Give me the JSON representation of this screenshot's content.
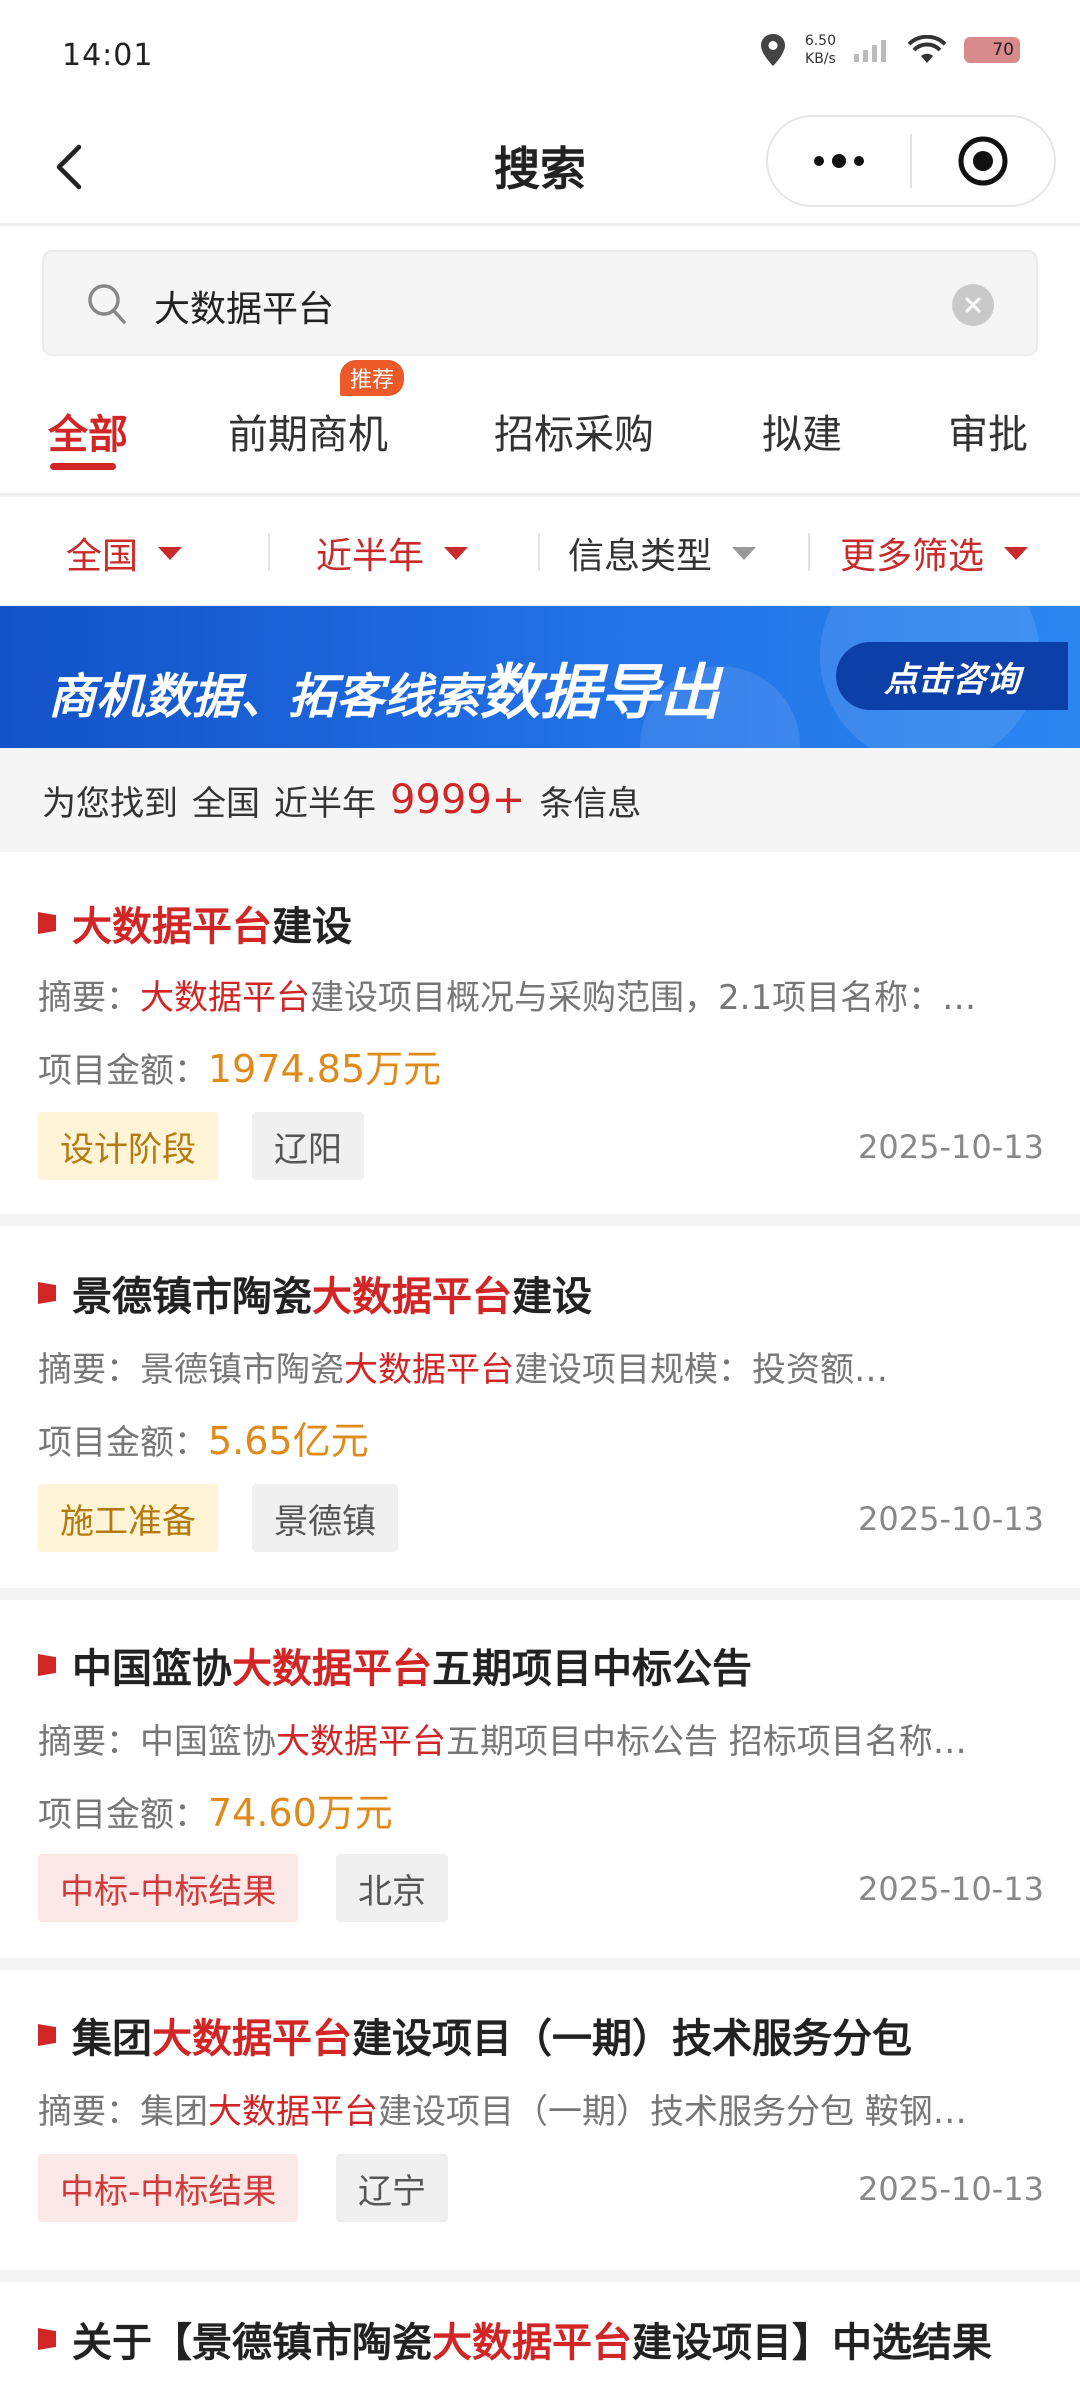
{
  "status_bar": {
    "time": "14:01",
    "net_speed_value": "6.50",
    "net_speed_unit": "KB/s",
    "battery": "70",
    "icons": [
      "location-icon",
      "signal-icon",
      "wifi-icon",
      "battery-icon"
    ]
  },
  "nav": {
    "title": "搜索",
    "back_icon": "chevron-left-icon",
    "more_icon": "more-dots-icon",
    "close_icon": "target-close-icon"
  },
  "search": {
    "value": "大数据平台",
    "icon": "search-icon",
    "clear_icon": "clear-icon"
  },
  "tabs": {
    "items": [
      "全部",
      "前期商机",
      "招标采购",
      "拟建",
      "审批"
    ],
    "active": "全部",
    "badge": "推荐"
  },
  "filters": {
    "region": "全国",
    "time": "近半年",
    "info_type": "信息类型",
    "more": "更多筛选"
  },
  "banner": {
    "text_part1": "商机数据、拓客线索",
    "text_part2": "数据导出",
    "button": "点击咨询"
  },
  "summary": {
    "prefix": "为您找到",
    "region": "全国",
    "time": "近半年",
    "count": "9999+",
    "suffix": "条信息"
  },
  "labels": {
    "summary_prefix": "摘要：",
    "amount_prefix": "项目金额："
  },
  "results": [
    {
      "title_pre": "",
      "title_hl": "大数据平台",
      "title_post": "建设",
      "summary_pre": "",
      "summary_hl": "大数据平台",
      "summary_post": "建设项目概况与采购范围，2.1项目名称：…",
      "amount": "1974.85万元",
      "stage": "设计阶段",
      "region": "辽阳",
      "date": "2025-10-13"
    },
    {
      "title_pre": "景德镇市陶瓷",
      "title_hl": "大数据平台",
      "title_post": "建设",
      "summary_pre": "景德镇市陶瓷",
      "summary_hl": "大数据平台",
      "summary_post": "建设项目规模：投资额…",
      "amount": "5.65亿元",
      "stage": "施工准备",
      "region": "景德镇",
      "date": "2025-10-13"
    },
    {
      "title_pre": "中国篮协",
      "title_hl": "大数据平台",
      "title_post": "五期项目中标公告",
      "summary_pre": "中国篮协",
      "summary_hl": "大数据平台",
      "summary_post": "五期项目中标公告 招标项目名称…",
      "amount": "74.60万元",
      "stage": "中标-中标结果",
      "region": "北京",
      "date": "2025-10-13"
    },
    {
      "title_pre": "集团",
      "title_hl": "大数据平台",
      "title_post": "建设项目（一期）技术服务分包",
      "summary_pre": "集团",
      "summary_hl": "大数据平台",
      "summary_post": "建设项目（一期）技术服务分包 鞍钢…",
      "stage": "中标-中标结果",
      "region": "辽宁",
      "date": "2025-10-13"
    },
    {
      "title_pre": "关于【景德镇市陶瓷",
      "title_hl": "大数据平台",
      "title_post": "建设项目】中选结果"
    }
  ]
}
